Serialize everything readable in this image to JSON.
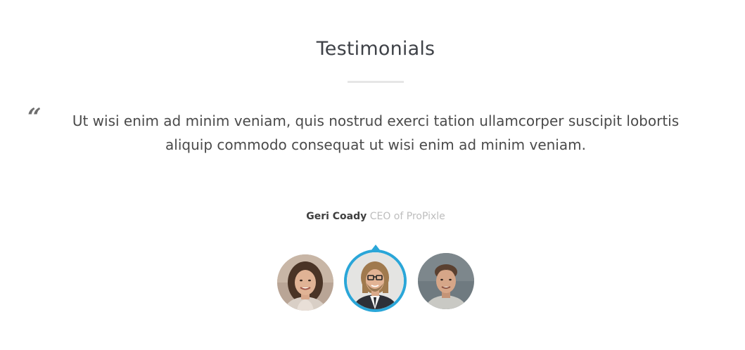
{
  "section": {
    "title": "Testimonials"
  },
  "testimonial": {
    "quote_icon": "quote-open-icon",
    "quote_mark": "“",
    "text": "Ut wisi enim ad minim veniam, quis nostrud exerci tation ullamcorper suscipit lobortis aliquip commodo consequat ut wisi enim ad minim veniam.",
    "author_name": "Geri Coady",
    "author_role": "CEO of ProPixle"
  },
  "avatars": [
    {
      "person": "woman-portrait",
      "active": false
    },
    {
      "person": "man-with-glasses-portrait",
      "active": true
    },
    {
      "person": "young-man-portrait",
      "active": false
    }
  ],
  "colors": {
    "accent": "#2aa6d8",
    "title": "#3f4248",
    "body_text": "#4a4a4a",
    "muted": "#bdbdbd",
    "divider": "#e6e6e6"
  }
}
